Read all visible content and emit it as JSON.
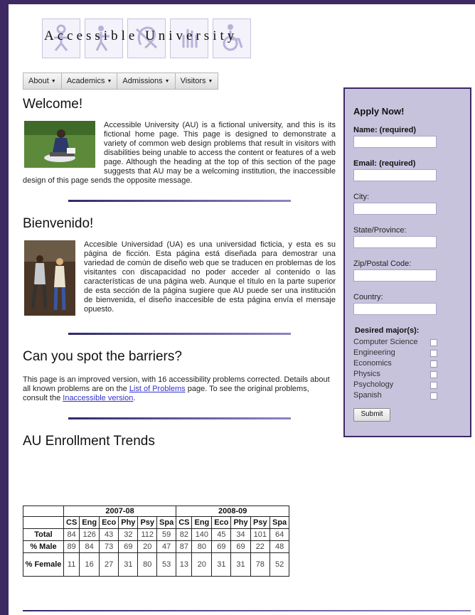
{
  "logo": {
    "text": "Accessible University"
  },
  "nav": [
    {
      "label": "About"
    },
    {
      "label": "Academics"
    },
    {
      "label": "Admissions"
    },
    {
      "label": "Visitors"
    }
  ],
  "welcome": {
    "title": "Welcome!",
    "text": "Accessible University (AU) is a fictional university, and this is its fictional home page. This page is designed to demonstrate a variety of common web design problems that result in visitors with disabilities being unable to access the content or features of a web page. Although the heading at the top of this section of the page suggests that AU may be a welcoming institution, the inaccessible design of this page sends the opposite message."
  },
  "bienvenido": {
    "title": "Bienvenido!",
    "text": "Accesible Universidad (UA) es una universidad ficticia, y esta es su página de ficción. Esta página está diseñada para demostrar una variedad de común de diseño web que se traducen en problemas de los visitantes con discapacidad no poder acceder al contenido o las características de una página web. Aunque el título en la parte superior de esta sección de la página sugiere que AU puede ser una institución de bienvenida, el diseño inaccesible de esta página envía el mensaje opuesto."
  },
  "barriers": {
    "title": "Can you spot the barriers?",
    "text1": "This page is an improved version, with 16 accessibility problems corrected. Details about all known problems are on the ",
    "link1": "List of Problems",
    "text2": " page. To see the original problems, consult the ",
    "link2": "Inaccessible version",
    "text3": "."
  },
  "enrollment": {
    "title": "AU Enrollment Trends",
    "years": [
      "2007-08",
      "2008-09"
    ],
    "columns": [
      "CS",
      "Eng",
      "Eco",
      "Phy",
      "Psy",
      "Spa",
      "CS",
      "Eng",
      "Eco",
      "Phy",
      "Psy",
      "Spa"
    ],
    "rows": [
      {
        "label": "Total",
        "values": [
          "84",
          "126",
          "43",
          "32",
          "112",
          "59",
          "82",
          "140",
          "45",
          "34",
          "101",
          "64"
        ]
      },
      {
        "label": "% Male",
        "values": [
          "89",
          "84",
          "73",
          "69",
          "20",
          "47",
          "87",
          "80",
          "69",
          "69",
          "22",
          "48"
        ]
      },
      {
        "label": "% Female",
        "values": [
          "11",
          "16",
          "27",
          "31",
          "80",
          "53",
          "13",
          "20",
          "31",
          "31",
          "78",
          "52"
        ]
      }
    ]
  },
  "form": {
    "title": "Apply Now!",
    "fields": [
      {
        "label": "Name: (required)",
        "bold": true
      },
      {
        "label": "Email: (required)",
        "bold": true
      },
      {
        "label": "City:",
        "bold": false
      },
      {
        "label": "State/Province:",
        "bold": false
      },
      {
        "label": "Zip/Postal Code:",
        "bold": false
      },
      {
        "label": "Country:",
        "bold": false
      }
    ],
    "majors_title": "Desired major(s):",
    "majors": [
      "Computer Science",
      "Engineering",
      "Economics",
      "Physics",
      "Psychology",
      "Spanish"
    ],
    "submit": "Submit"
  },
  "colors": {
    "frame": "#3d2a63",
    "form_bg": "#c8c3dd",
    "link": "#3333cc"
  }
}
